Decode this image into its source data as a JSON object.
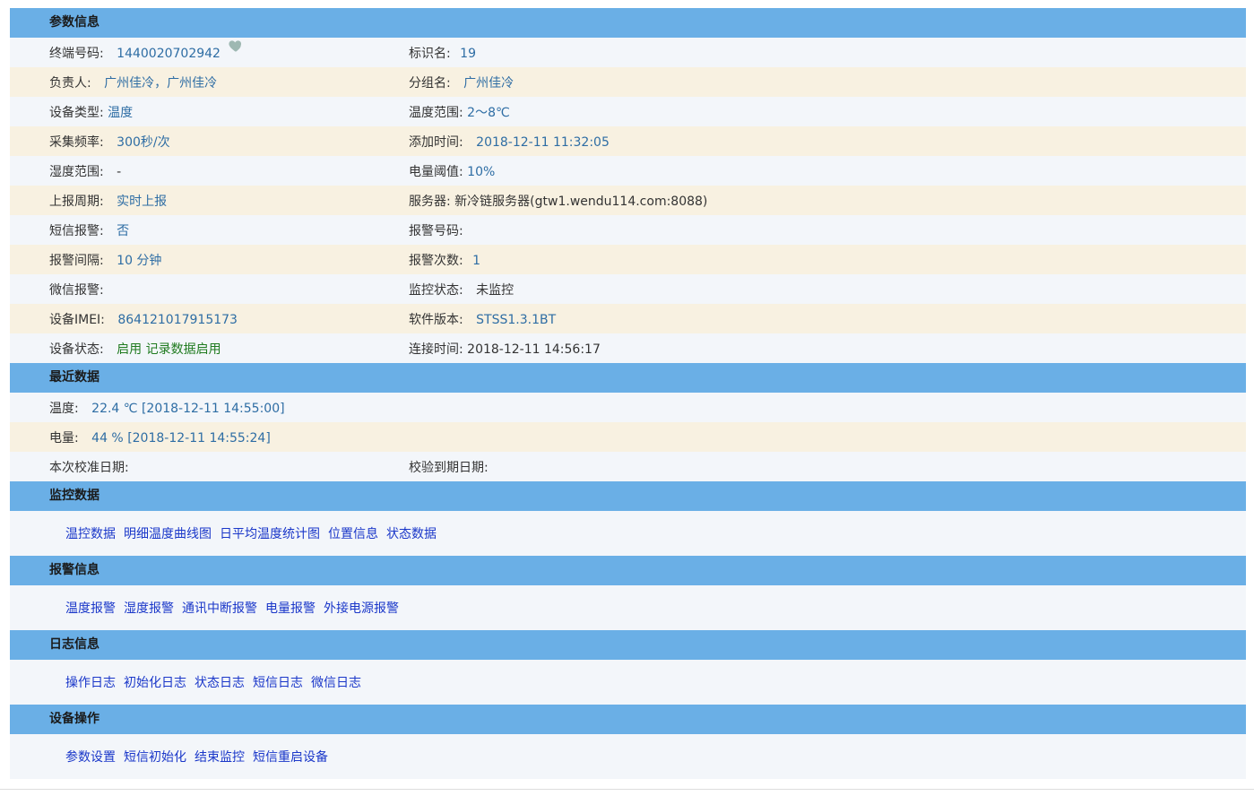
{
  "sections": {
    "params_title": "参数信息",
    "recent_title": "最近数据",
    "monitor_title": "监控数据",
    "alarm_title": "报警信息",
    "log_title": "日志信息",
    "ops_title": "设备操作"
  },
  "params": [
    {
      "l_label": "终端号码:",
      "l_value": "1440020702942",
      "r_label": "标识名:",
      "r_value": "19"
    },
    {
      "l_label": "负责人:",
      "l_value": "广州佳冷，广州佳冷",
      "r_label": "分组名:",
      "r_value": "广州佳冷"
    },
    {
      "l_label": "设备类型:",
      "l_value": "温度",
      "r_label": "温度范围:",
      "r_value": "2～8℃"
    },
    {
      "l_label": "采集频率:",
      "l_value": "300秒/次",
      "r_label": "添加时间:",
      "r_value": "2018-12-11 11:32:05"
    },
    {
      "l_label": "湿度范围:",
      "l_value": "-",
      "r_label": "电量阈值:",
      "r_value": "10%"
    },
    {
      "l_label": "上报周期:",
      "l_value": "实时上报",
      "r_label": "服务器:",
      "r_value": "新冷链服务器(gtw1.wendu114.com:8088)"
    },
    {
      "l_label": "短信报警:",
      "l_value": "否",
      "r_label": "报警号码:",
      "r_value": ""
    },
    {
      "l_label": "报警间隔:",
      "l_value": "10 分钟",
      "r_label": "报警次数:",
      "r_value": "1"
    },
    {
      "l_label": "微信报警:",
      "l_value": "",
      "r_label": "监控状态:",
      "r_value": "未监控"
    },
    {
      "l_label": "设备IMEI:",
      "l_value": "864121017915173",
      "r_label": "软件版本:",
      "r_value": "STSS1.3.1BT"
    },
    {
      "l_label": "设备状态:",
      "l_value": "启用 记录数据启用",
      "r_label": "连接时间:",
      "r_value": "2018-12-11 14:56:17"
    }
  ],
  "recent": {
    "temp_label": "温度:",
    "temp_value": "22.4 ℃ [2018-12-11 14:55:00]",
    "power_label": "电量:",
    "power_value": "44 % [2018-12-11 14:55:24]",
    "calib_label": "本次校准日期:",
    "expire_label": "校验到期日期:"
  },
  "monitor_links": [
    "温控数据",
    "明细温度曲线图",
    "日平均温度统计图",
    "位置信息",
    "状态数据"
  ],
  "alarm_links": [
    "温度报警",
    "湿度报警",
    "通讯中断报警",
    "电量报警",
    "外接电源报警"
  ],
  "log_links": [
    "操作日志",
    "初始化日志",
    "状态日志",
    "短信日志",
    "微信日志"
  ],
  "ops_links": [
    "参数设置",
    "短信初始化",
    "结束监控",
    "短信重启设备"
  ],
  "icons": {
    "favorite": "heart-icon"
  },
  "colors": {
    "header": "#6aafe6",
    "value": "#2e6da4",
    "link": "#1a37c9",
    "status_green": "#1f7a1f"
  }
}
